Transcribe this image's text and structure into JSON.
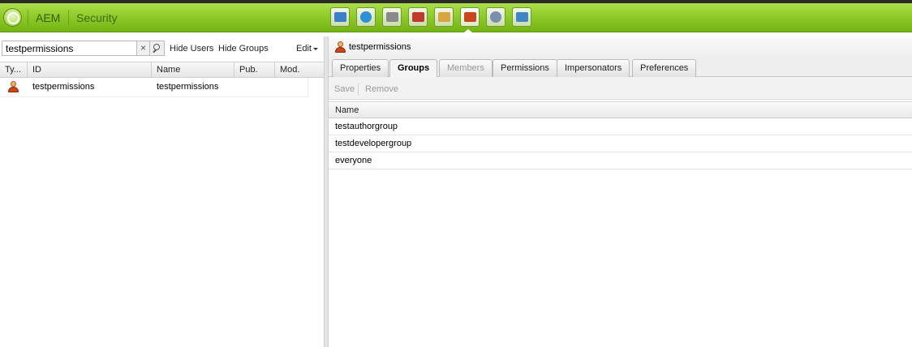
{
  "header": {
    "brand": "AEM",
    "section": "Security",
    "tools": [
      {
        "icon": "sites-icon",
        "color": "#3b7ec9"
      },
      {
        "icon": "globe-icon",
        "color": "#2f8fd8"
      },
      {
        "icon": "camera-icon",
        "color": "#8a8a8a"
      },
      {
        "icon": "campaign-icon",
        "color": "#c0392b"
      },
      {
        "icon": "inbox-icon",
        "color": "#d9a441"
      },
      {
        "icon": "users-icon",
        "color": "#c8461a"
      },
      {
        "icon": "tools-icon",
        "color": "#7a8fb0"
      },
      {
        "icon": "tag-icon",
        "color": "#3f86c6"
      }
    ]
  },
  "left": {
    "search": {
      "value": "testpermissions"
    },
    "clear_glyph": "×",
    "buttons": {
      "hide_users": "Hide Users",
      "hide_groups": "Hide Groups",
      "edit": "Edit"
    },
    "columns": [
      "Ty...",
      "ID",
      "Name",
      "Pub.",
      "Mod."
    ],
    "rows": [
      {
        "type_icon": "user-icon",
        "id": "testpermissions",
        "name": "testpermissions",
        "pub": "",
        "mod": ""
      }
    ]
  },
  "right": {
    "title": "testpermissions",
    "tabs": [
      {
        "label": "Properties",
        "state": "normal"
      },
      {
        "label": "Groups",
        "state": "active"
      },
      {
        "label": "Members",
        "state": "disabled"
      },
      {
        "label": "Permissions",
        "state": "normal"
      },
      {
        "label": "Impersonators",
        "state": "normal"
      },
      {
        "label": "Preferences",
        "state": "normal"
      }
    ],
    "actions": {
      "save": "Save",
      "remove": "Remove"
    },
    "column": "Name",
    "groups": [
      "testauthorgroup",
      "testdevelopergroup",
      "everyone"
    ]
  }
}
